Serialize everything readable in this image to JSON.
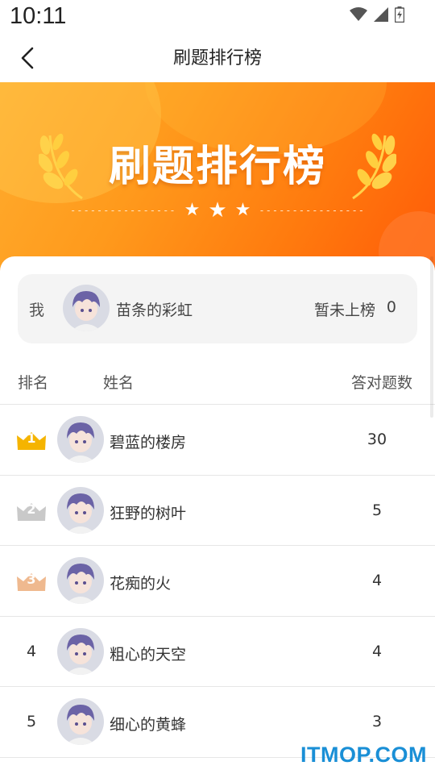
{
  "status_bar": {
    "time": "10:11",
    "icons": [
      "wifi-icon",
      "signal-icon",
      "battery-charging-icon"
    ]
  },
  "header": {
    "title": "刷题排行榜",
    "back_icon": "chevron-left-icon"
  },
  "banner": {
    "title": "刷题排行榜",
    "stars": [
      "★",
      "★",
      "★"
    ],
    "colors": {
      "start": "#ffad2e",
      "end": "#ff5a08",
      "laurel": "#ffd24a"
    }
  },
  "me": {
    "label": "我",
    "name": "苗条的彩虹",
    "status": "暂未上榜",
    "score": "0"
  },
  "table": {
    "headers": {
      "rank": "排名",
      "name": "姓名",
      "score": "答对题数"
    },
    "rows": [
      {
        "rank": "1",
        "name": "碧蓝的楼房",
        "score": "30",
        "medal": "gold"
      },
      {
        "rank": "2",
        "name": "狂野的树叶",
        "score": "5",
        "medal": "silver"
      },
      {
        "rank": "3",
        "name": "花痴的火",
        "score": "4",
        "medal": "bronze"
      },
      {
        "rank": "4",
        "name": "粗心的天空",
        "score": "4",
        "medal": ""
      },
      {
        "rank": "5",
        "name": "细心的黄蜂",
        "score": "3",
        "medal": ""
      }
    ]
  },
  "medal_colors": {
    "gold": "#f5b400",
    "silver": "#c9c9c9",
    "bronze": "#efb98f"
  },
  "watermark": "ITMOP.COM"
}
